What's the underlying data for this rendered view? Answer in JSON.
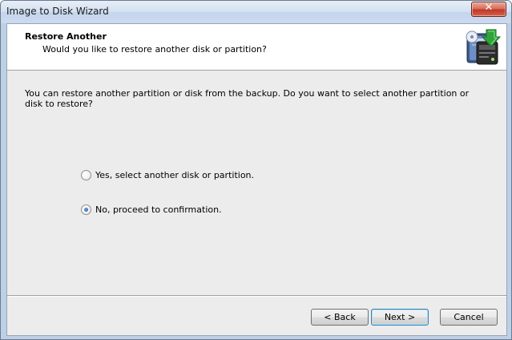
{
  "window": {
    "title": "Image to Disk Wizard",
    "close_symbol": "✕"
  },
  "header": {
    "title": "Restore Another",
    "subtitle": "Would you like to restore another disk or partition?",
    "icon": "disk-restore-icon"
  },
  "body": {
    "description": "You can restore another partition or disk from the backup. Do you want to select another partition or disk to restore?",
    "options": [
      {
        "label": "Yes, select another disk or partition.",
        "selected": false
      },
      {
        "label": "No, proceed to confirmation.",
        "selected": true
      }
    ]
  },
  "buttons": {
    "back": "< Back",
    "next": "Next >",
    "cancel": "Cancel"
  }
}
